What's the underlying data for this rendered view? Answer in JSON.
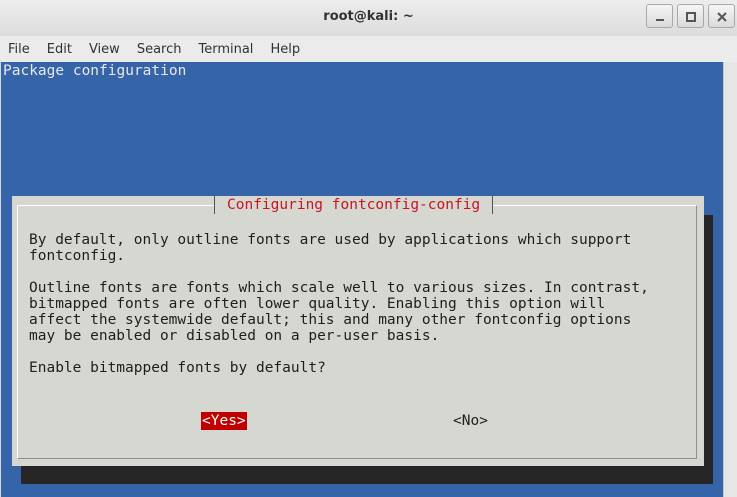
{
  "window": {
    "title": "root@kali: ~",
    "controls": [
      "minimize-icon",
      "maximize-icon",
      "close-icon"
    ]
  },
  "menubar": {
    "items": [
      "File",
      "Edit",
      "View",
      "Search",
      "Terminal",
      "Help"
    ]
  },
  "terminal": {
    "header": "Package configuration",
    "colors": {
      "background": "#3564a8",
      "dialog": "#d7d7d2",
      "accent": "#c8141e",
      "selected": "#c00000"
    },
    "dialog": {
      "title": "Configuring fontconfig-config",
      "body": "By default, only outline fonts are used by applications which support\nfontconfig.\n\nOutline fonts are fonts which scale well to various sizes. In contrast,\nbitmapped fonts are often lower quality. Enabling this option will\naffect the systemwide default; this and many other fontconfig options\nmay be enabled or disabled on a per-user basis.\n\nEnable bitmapped fonts by default?",
      "yes_label": "<Yes>",
      "no_label": "<No>"
    }
  }
}
